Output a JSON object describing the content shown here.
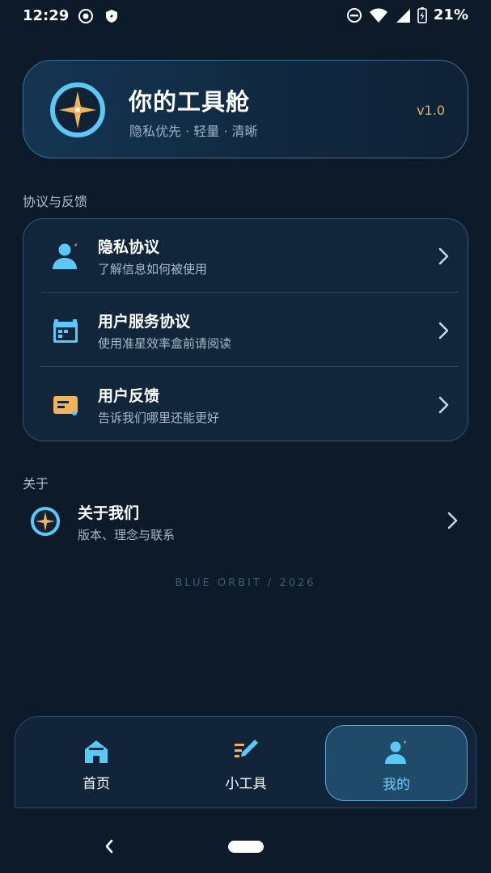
{
  "status_bar": {
    "time": "12:29",
    "battery": "21%"
  },
  "hero": {
    "title": "你的工具舱",
    "subtitle": "隐私优先 · 轻量 · 清晰",
    "version": "v1.0",
    "logo_icon": "compass-star-icon"
  },
  "section_agreements": {
    "label": "协议与反馈",
    "items": [
      {
        "title": "隐私协议",
        "desc": "了解信息如何被使用",
        "icon": "user-icon"
      },
      {
        "title": "用户服务协议",
        "desc": "使用准星效率盒前请阅读",
        "icon": "calendar-icon"
      },
      {
        "title": "用户反馈",
        "desc": "告诉我们哪里还能更好",
        "icon": "message-icon"
      }
    ]
  },
  "section_about": {
    "label": "关于",
    "item": {
      "title": "关于我们",
      "desc": "版本、理念与联系",
      "icon": "compass-star-icon"
    }
  },
  "footer": {
    "brand": "BLUE ORBIT / 2026"
  },
  "bottom_nav": {
    "items": [
      {
        "label": "首页",
        "icon": "home-icon",
        "active": false
      },
      {
        "label": "小工具",
        "icon": "pencil-tools-icon",
        "active": false
      },
      {
        "label": "我的",
        "icon": "user-icon",
        "active": true
      }
    ]
  },
  "colors": {
    "background": "#0d1a2a",
    "accent_blue": "#5cc8f5",
    "accent_orange": "#f2b35b",
    "version_gold": "#e2b15f",
    "active_tab_text": "#6fd0ff"
  }
}
